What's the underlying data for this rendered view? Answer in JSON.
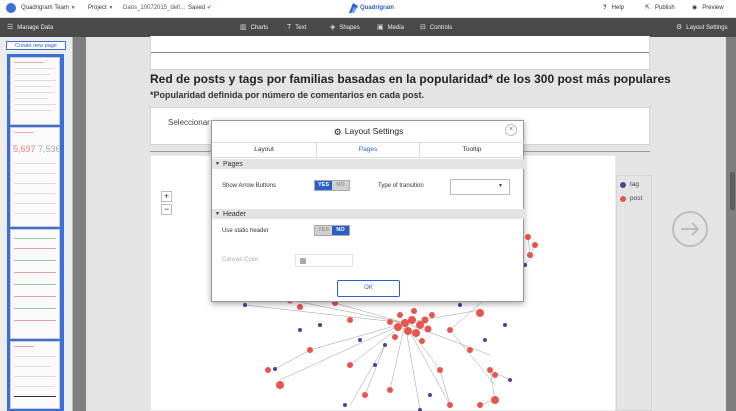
{
  "topbar": {
    "team": "Quadrigram Team",
    "project_label": "Project",
    "file_name": "Dans_10072015_defi...",
    "saved": "Saved",
    "brand": "Quadrigram",
    "help": "Help",
    "publish": "Publish",
    "preview": "Preview"
  },
  "toolbar": {
    "manage_data": "Manage Data",
    "charts": "Charts",
    "text": "Text",
    "shapes": "Shapes",
    "media": "Media",
    "controls": "Controls",
    "layout_settings": "Layout Settings"
  },
  "sidebar": {
    "create_new_page": "Create new page",
    "thumb_numbers": [
      "5,697",
      "7,536"
    ]
  },
  "page": {
    "title": "Red de posts y tags por familias basadas en la popularidad* de los 300 post más populares",
    "subtitle": "*Popularidad definida por número de comentarios en cada post.",
    "select_label": "Seleccionar",
    "zoom_in": "+",
    "zoom_out": "−"
  },
  "legend": {
    "items": [
      {
        "label": "tag",
        "color": "#5b3c98"
      },
      {
        "label": "post",
        "color": "#e8554e"
      }
    ]
  },
  "colors": {
    "accent": "#2a61c9",
    "toolbar_bg": "#4a4a4a",
    "node_post": "#e8554e",
    "node_tag": "#5b3c98"
  },
  "modal": {
    "title": "Layout Settings",
    "close": "×",
    "tabs": [
      {
        "label": "Layout",
        "active": false
      },
      {
        "label": "Pages",
        "active": true
      },
      {
        "label": "Tooltip",
        "active": false
      }
    ],
    "pages_section": {
      "heading": "Pages",
      "show_arrow_buttons_label": "Show Arrow Buttons",
      "yes": "YES",
      "no": "NO",
      "show_arrow_buttons_value": "YES",
      "type_of_transition_label": "Type of transition",
      "type_of_transition_value": ""
    },
    "header_section": {
      "heading": "Header",
      "use_static_header_label": "Use static header",
      "yes": "YES",
      "no": "NO",
      "use_static_header_value": "NO",
      "canvas_color_label": "Canvas Color"
    },
    "ok": "OK"
  }
}
